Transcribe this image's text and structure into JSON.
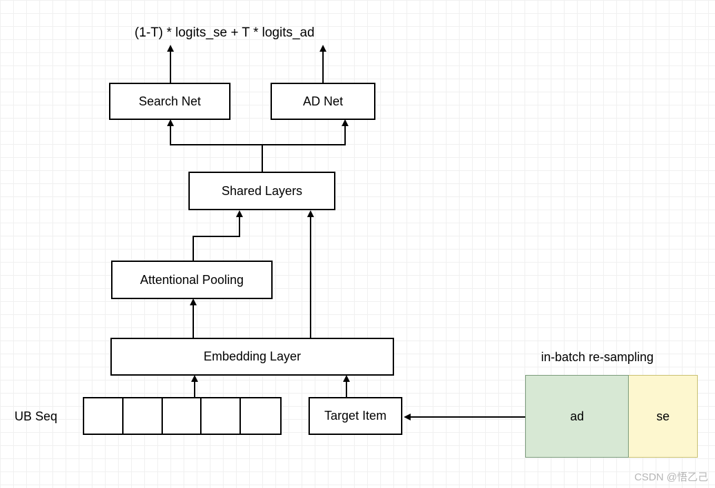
{
  "formula": "(1-T) * logits_se +  T * logits_ad",
  "nodes": {
    "search_net": "Search Net",
    "ad_net": "AD Net",
    "shared_layers": "Shared Layers",
    "attentional_pooling": "Attentional Pooling",
    "embedding_layer": "Embedding Layer",
    "target_item": "Target Item"
  },
  "ub_seq_label": "UB Seq",
  "resampling_label": "in-batch re-sampling",
  "resampling_cells": {
    "ad": "ad",
    "se": "se"
  },
  "watermark": "CSDN @悟乙己"
}
